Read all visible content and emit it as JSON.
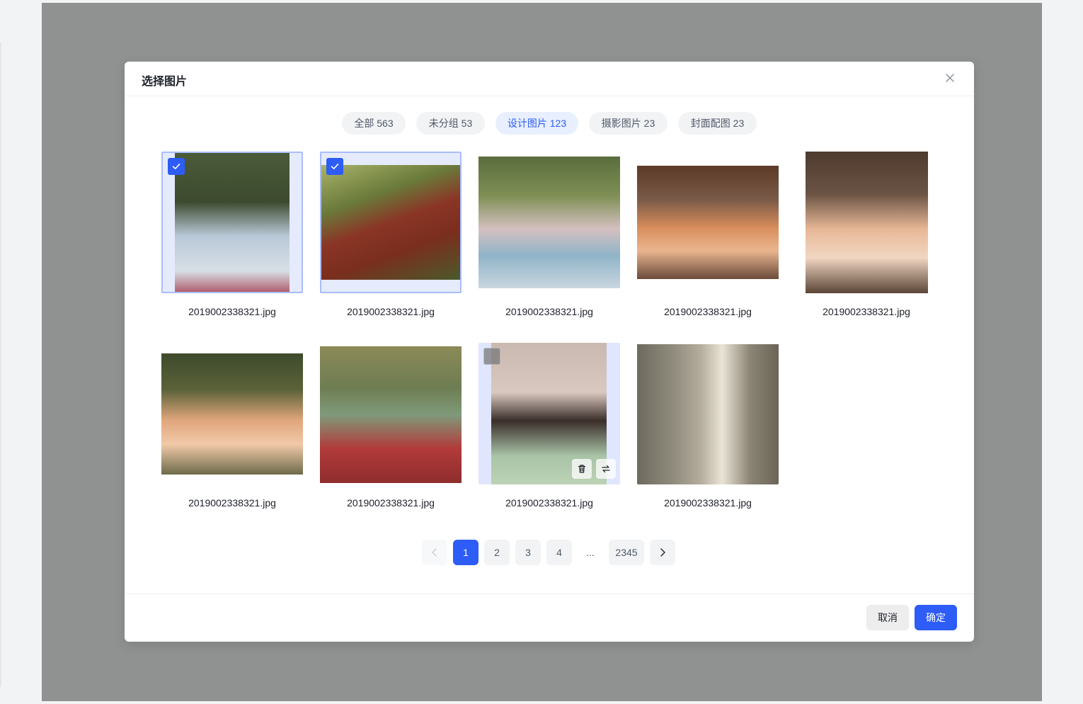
{
  "dialog": {
    "title": "选择图片"
  },
  "tabs": [
    {
      "label": "全部 563",
      "active": false
    },
    {
      "label": "未分组 53",
      "active": false
    },
    {
      "label": "设计图片 123",
      "active": true
    },
    {
      "label": "摄影图片 23",
      "active": false
    },
    {
      "label": "封面配图 23",
      "active": false
    }
  ],
  "images": [
    {
      "filename": "2019002338321.jpg",
      "selected": true
    },
    {
      "filename": "2019002338321.jpg",
      "selected": true
    },
    {
      "filename": "2019002338321.jpg",
      "selected": false
    },
    {
      "filename": "2019002338321.jpg",
      "selected": false
    },
    {
      "filename": "2019002338321.jpg",
      "selected": false
    },
    {
      "filename": "2019002338321.jpg",
      "selected": false
    },
    {
      "filename": "2019002338321.jpg",
      "selected": false
    },
    {
      "filename": "2019002338321.jpg",
      "selected": false,
      "hovered": true
    },
    {
      "filename": "2019002338321.jpg",
      "selected": false
    }
  ],
  "pagination": {
    "pages": [
      "1",
      "2",
      "3",
      "4",
      "...",
      "2345"
    ],
    "current": "1"
  },
  "footer": {
    "cancel_label": "取消",
    "ok_label": "确定"
  },
  "colors": {
    "accent": "#2d5cf6",
    "overlay": "#909191"
  },
  "icons": {
    "close": "close-icon",
    "check": "checkmark-icon",
    "delete": "trash-icon",
    "replace": "swap-icon",
    "prev": "chevron-left-icon",
    "next": "chevron-right-icon"
  }
}
